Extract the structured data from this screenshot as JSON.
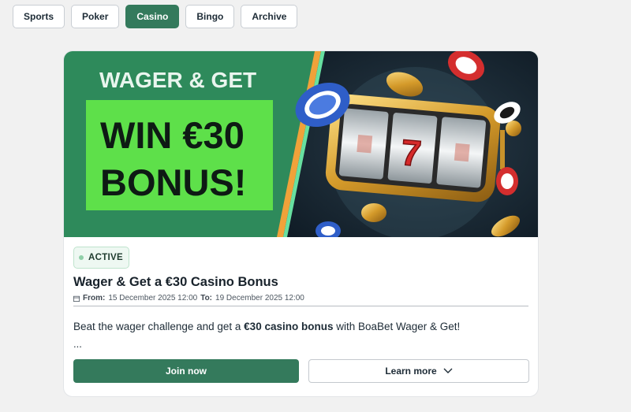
{
  "tabs": [
    {
      "label": "Sports",
      "active": false
    },
    {
      "label": "Poker",
      "active": false
    },
    {
      "label": "Casino",
      "active": true
    },
    {
      "label": "Bingo",
      "active": false
    },
    {
      "label": "Archive",
      "active": false
    }
  ],
  "promo": {
    "banner": {
      "headline": "WAGER & GET",
      "big_line1": "WIN €30",
      "big_line2": "BONUS!",
      "reel_symbol": "7"
    },
    "status": "ACTIVE",
    "title": "Wager & Get a €30 Casino Bonus",
    "dates": {
      "from_label": "From:",
      "from_value": "15 December 2025 12:00",
      "to_label": "To:",
      "to_value": "19 December 2025 12:00"
    },
    "description": {
      "before": "Beat the wager challenge and get a ",
      "bold": "€30 casino bonus",
      "after": " with BoaBet Wager & Get!"
    },
    "ellipsis": "...",
    "join_label": "Join now",
    "learn_more_label": "Learn more"
  },
  "colors": {
    "brand_green": "#347a5c",
    "banner_green": "#2e8a5b",
    "highlight_green": "#5ee04a",
    "banner_dark": "#152431",
    "accent_orange": "#f0a23a"
  },
  "icons": {
    "calendar": "calendar-icon",
    "learn_more": "chevron-down-icon",
    "status": "status-dot-icon"
  }
}
